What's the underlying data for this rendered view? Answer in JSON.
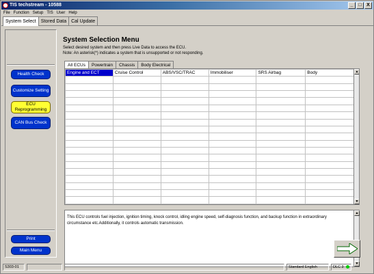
{
  "window": {
    "title": "TIS techstream - 10588",
    "minimize_glyph": "_",
    "maximize_glyph": "□",
    "close_glyph": "X"
  },
  "menu": {
    "items": [
      "File",
      "Function",
      "Setup",
      "TIS",
      "User",
      "Help"
    ]
  },
  "top_tabs": [
    "System Select",
    "Stored Data",
    "Cal Update"
  ],
  "sidebar": {
    "buttons": [
      "Health Check",
      "Customize Setting",
      "ECU Reprogramming",
      "CAN Bus Check"
    ],
    "bottom_buttons": [
      "Print",
      "Main Menu"
    ]
  },
  "main": {
    "heading": "System Selection Menu",
    "line1": "Select desired system and then press Live Data to access the ECU.",
    "line2": "Note: An asterisk(*) indicates a system that is unsupported or not responding.",
    "tabs": [
      "All ECUs",
      "Powertrain",
      "Chassis",
      "Body Electrical"
    ],
    "grid_row1": [
      "Engine and ECT",
      "Cruise Control",
      "ABS/VSC/TRAC",
      "Immobiliser",
      "SRS Airbag",
      "Body"
    ],
    "description": "This ECU controls fuel injection, ignition timing, knock control, idling engine speed, self-diagnosis function, and backup function in extraordinary circumstance etc.Additionally, it controls automatic transmission."
  },
  "status": {
    "left": "S303-01",
    "language": "Standard English",
    "dlc": "DLC 3"
  },
  "colors": {
    "blue_button": "#0033cc",
    "yellow_button": "#ffff33",
    "selection": "#0000cc",
    "arrow": "#e00000",
    "status_dot": "#00cc00"
  }
}
